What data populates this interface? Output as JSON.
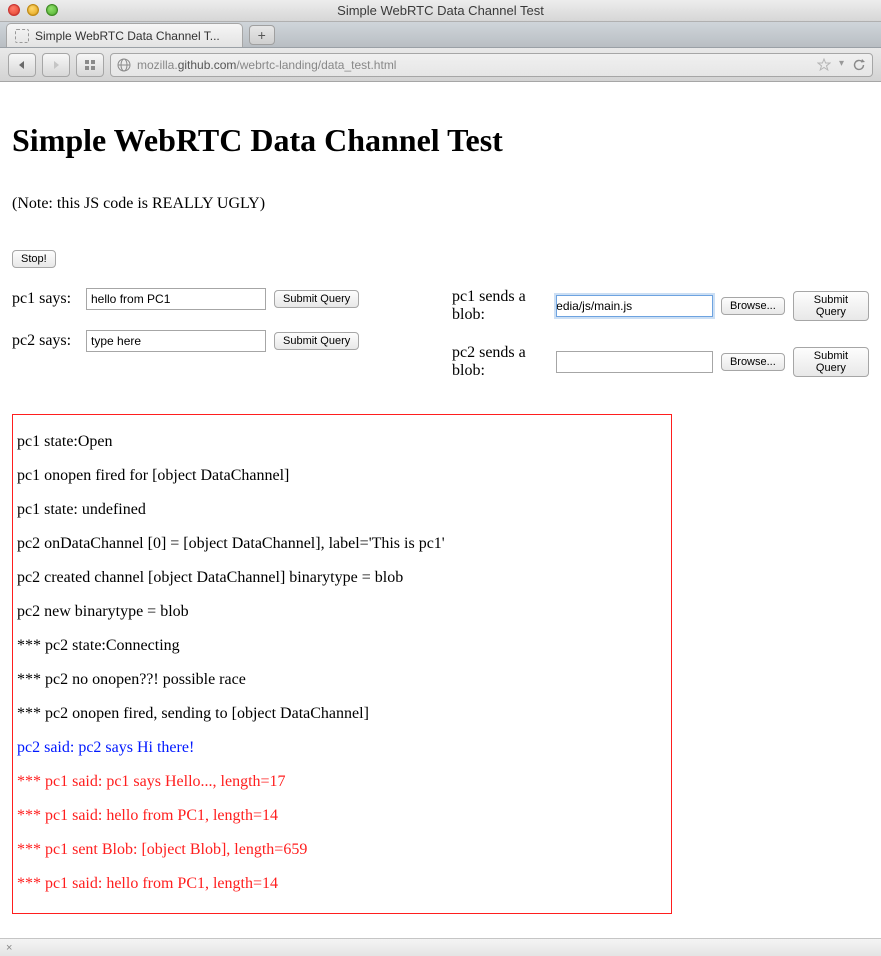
{
  "window": {
    "title": "Simple WebRTC Data Channel Test"
  },
  "tab": {
    "title": "Simple WebRTC Data Channel T..."
  },
  "url": {
    "host_prefix": "mozilla.",
    "host": "github.com",
    "path": "/webrtc-landing/data_test.html"
  },
  "page": {
    "heading": "Simple WebRTC Data Channel Test",
    "note": "(Note: this JS code is REALLY UGLY)",
    "stop_label": "Stop!",
    "pc1_says_label": "pc1 says:",
    "pc1_says_value": "hello from PC1",
    "pc2_says_label": "pc2 says:",
    "pc2_says_value": "type here",
    "submit_label": "Submit Query",
    "pc1_blob_label": "pc1 sends a blob:",
    "pc1_blob_file": "ipl/getusermedia/js/main.js",
    "pc2_blob_label": "pc2 sends a blob:",
    "pc2_blob_file": "",
    "browse_label": "Browse...",
    "status_close_icon": "×"
  },
  "log": [
    {
      "text": "pc1 state:Open",
      "cls": ""
    },
    {
      "text": "pc1 onopen fired for [object DataChannel]",
      "cls": ""
    },
    {
      "text": "pc1 state: undefined",
      "cls": ""
    },
    {
      "text": "pc2 onDataChannel [0] = [object DataChannel], label='This is pc1'",
      "cls": ""
    },
    {
      "text": "pc2 created channel [object DataChannel] binarytype = blob",
      "cls": ""
    },
    {
      "text": "pc2 new binarytype = blob",
      "cls": ""
    },
    {
      "text": "*** pc2 state:Connecting",
      "cls": ""
    },
    {
      "text": "*** pc2 no onopen??! possible race",
      "cls": ""
    },
    {
      "text": "*** pc2 onopen fired, sending to [object DataChannel]",
      "cls": ""
    },
    {
      "text": "pc2 said: pc2 says Hi there!",
      "cls": "blue"
    },
    {
      "text": "*** pc1 said: pc1 says Hello..., length=17",
      "cls": "red"
    },
    {
      "text": "*** pc1 said: hello from PC1, length=14",
      "cls": "red"
    },
    {
      "text": "*** pc1 sent Blob: [object Blob], length=659",
      "cls": "red"
    },
    {
      "text": "*** pc1 said: hello from PC1, length=14",
      "cls": "red"
    }
  ]
}
